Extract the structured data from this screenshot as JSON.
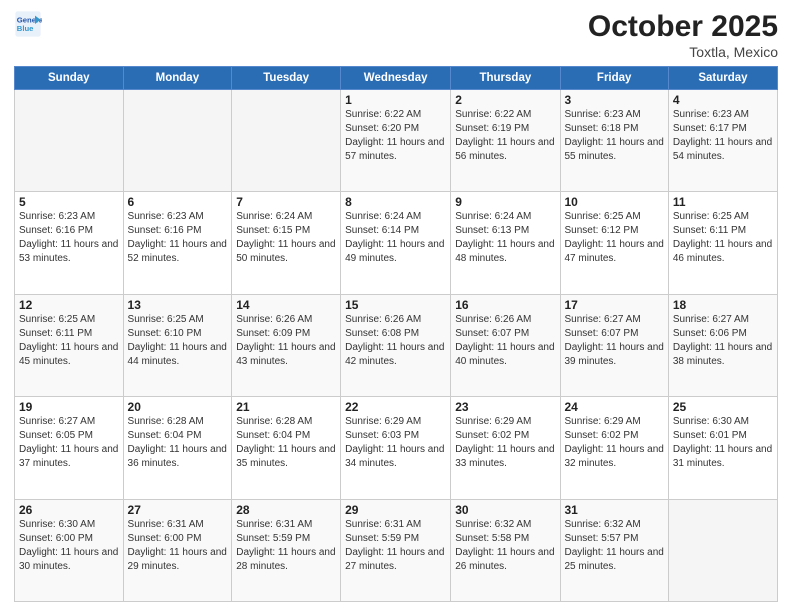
{
  "header": {
    "logo_line1": "General",
    "logo_line2": "Blue",
    "month": "October 2025",
    "location": "Toxtla, Mexico"
  },
  "days_of_week": [
    "Sunday",
    "Monday",
    "Tuesday",
    "Wednesday",
    "Thursday",
    "Friday",
    "Saturday"
  ],
  "weeks": [
    [
      {
        "day": "",
        "info": ""
      },
      {
        "day": "",
        "info": ""
      },
      {
        "day": "",
        "info": ""
      },
      {
        "day": "1",
        "info": "Sunrise: 6:22 AM\nSunset: 6:20 PM\nDaylight: 11 hours and 57 minutes."
      },
      {
        "day": "2",
        "info": "Sunrise: 6:22 AM\nSunset: 6:19 PM\nDaylight: 11 hours and 56 minutes."
      },
      {
        "day": "3",
        "info": "Sunrise: 6:23 AM\nSunset: 6:18 PM\nDaylight: 11 hours and 55 minutes."
      },
      {
        "day": "4",
        "info": "Sunrise: 6:23 AM\nSunset: 6:17 PM\nDaylight: 11 hours and 54 minutes."
      }
    ],
    [
      {
        "day": "5",
        "info": "Sunrise: 6:23 AM\nSunset: 6:16 PM\nDaylight: 11 hours and 53 minutes."
      },
      {
        "day": "6",
        "info": "Sunrise: 6:23 AM\nSunset: 6:16 PM\nDaylight: 11 hours and 52 minutes."
      },
      {
        "day": "7",
        "info": "Sunrise: 6:24 AM\nSunset: 6:15 PM\nDaylight: 11 hours and 50 minutes."
      },
      {
        "day": "8",
        "info": "Sunrise: 6:24 AM\nSunset: 6:14 PM\nDaylight: 11 hours and 49 minutes."
      },
      {
        "day": "9",
        "info": "Sunrise: 6:24 AM\nSunset: 6:13 PM\nDaylight: 11 hours and 48 minutes."
      },
      {
        "day": "10",
        "info": "Sunrise: 6:25 AM\nSunset: 6:12 PM\nDaylight: 11 hours and 47 minutes."
      },
      {
        "day": "11",
        "info": "Sunrise: 6:25 AM\nSunset: 6:11 PM\nDaylight: 11 hours and 46 minutes."
      }
    ],
    [
      {
        "day": "12",
        "info": "Sunrise: 6:25 AM\nSunset: 6:11 PM\nDaylight: 11 hours and 45 minutes."
      },
      {
        "day": "13",
        "info": "Sunrise: 6:25 AM\nSunset: 6:10 PM\nDaylight: 11 hours and 44 minutes."
      },
      {
        "day": "14",
        "info": "Sunrise: 6:26 AM\nSunset: 6:09 PM\nDaylight: 11 hours and 43 minutes."
      },
      {
        "day": "15",
        "info": "Sunrise: 6:26 AM\nSunset: 6:08 PM\nDaylight: 11 hours and 42 minutes."
      },
      {
        "day": "16",
        "info": "Sunrise: 6:26 AM\nSunset: 6:07 PM\nDaylight: 11 hours and 40 minutes."
      },
      {
        "day": "17",
        "info": "Sunrise: 6:27 AM\nSunset: 6:07 PM\nDaylight: 11 hours and 39 minutes."
      },
      {
        "day": "18",
        "info": "Sunrise: 6:27 AM\nSunset: 6:06 PM\nDaylight: 11 hours and 38 minutes."
      }
    ],
    [
      {
        "day": "19",
        "info": "Sunrise: 6:27 AM\nSunset: 6:05 PM\nDaylight: 11 hours and 37 minutes."
      },
      {
        "day": "20",
        "info": "Sunrise: 6:28 AM\nSunset: 6:04 PM\nDaylight: 11 hours and 36 minutes."
      },
      {
        "day": "21",
        "info": "Sunrise: 6:28 AM\nSunset: 6:04 PM\nDaylight: 11 hours and 35 minutes."
      },
      {
        "day": "22",
        "info": "Sunrise: 6:29 AM\nSunset: 6:03 PM\nDaylight: 11 hours and 34 minutes."
      },
      {
        "day": "23",
        "info": "Sunrise: 6:29 AM\nSunset: 6:02 PM\nDaylight: 11 hours and 33 minutes."
      },
      {
        "day": "24",
        "info": "Sunrise: 6:29 AM\nSunset: 6:02 PM\nDaylight: 11 hours and 32 minutes."
      },
      {
        "day": "25",
        "info": "Sunrise: 6:30 AM\nSunset: 6:01 PM\nDaylight: 11 hours and 31 minutes."
      }
    ],
    [
      {
        "day": "26",
        "info": "Sunrise: 6:30 AM\nSunset: 6:00 PM\nDaylight: 11 hours and 30 minutes."
      },
      {
        "day": "27",
        "info": "Sunrise: 6:31 AM\nSunset: 6:00 PM\nDaylight: 11 hours and 29 minutes."
      },
      {
        "day": "28",
        "info": "Sunrise: 6:31 AM\nSunset: 5:59 PM\nDaylight: 11 hours and 28 minutes."
      },
      {
        "day": "29",
        "info": "Sunrise: 6:31 AM\nSunset: 5:59 PM\nDaylight: 11 hours and 27 minutes."
      },
      {
        "day": "30",
        "info": "Sunrise: 6:32 AM\nSunset: 5:58 PM\nDaylight: 11 hours and 26 minutes."
      },
      {
        "day": "31",
        "info": "Sunrise: 6:32 AM\nSunset: 5:57 PM\nDaylight: 11 hours and 25 minutes."
      },
      {
        "day": "",
        "info": ""
      }
    ]
  ]
}
